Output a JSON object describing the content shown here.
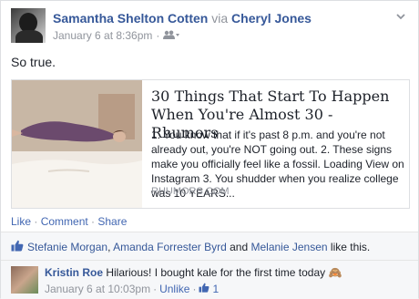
{
  "post": {
    "author": "Samantha Shelton Cotten",
    "via_word": "via",
    "via_name": "Cheryl Jones",
    "timestamp": "January 6 at 8:36pm",
    "meta_dot": "·",
    "text": "So true."
  },
  "link": {
    "title": "30 Things That Start To Happen When You're Almost 30 - Rhumors",
    "description": "1. You know that if it's past 8 p.m. and you're not already out, you're NOT going out. 2. These signs make you officially feel like a fossil. Loading View on Instagram 3. You shudder when you realize college was 10 YEARS...",
    "domain": "RHUMORS.COM"
  },
  "actions": {
    "like": "Like",
    "comment": "Comment",
    "share": "Share",
    "dot": " · "
  },
  "likes": {
    "names": [
      "Stefanie Morgan",
      "Amanda Forrester Byrd",
      "Melanie Jensen"
    ],
    "sep1": ", ",
    "and": " and ",
    "suffix": " like this."
  },
  "comment": {
    "author": "Kristin Roe",
    "text": " Hilarious! I bought kale for the first time today 🙈",
    "timestamp": "January 6 at 10:03pm",
    "dot": "·",
    "unlike": "Unlike",
    "dot2": "·",
    "like_count": "1"
  },
  "colors": {
    "link_blue": "#365899",
    "muted": "#90949c",
    "background": "#f6f7f9"
  },
  "icons": [
    "group-audience-icon",
    "dropdown-chevron-icon",
    "thumbs-up-icon"
  ]
}
